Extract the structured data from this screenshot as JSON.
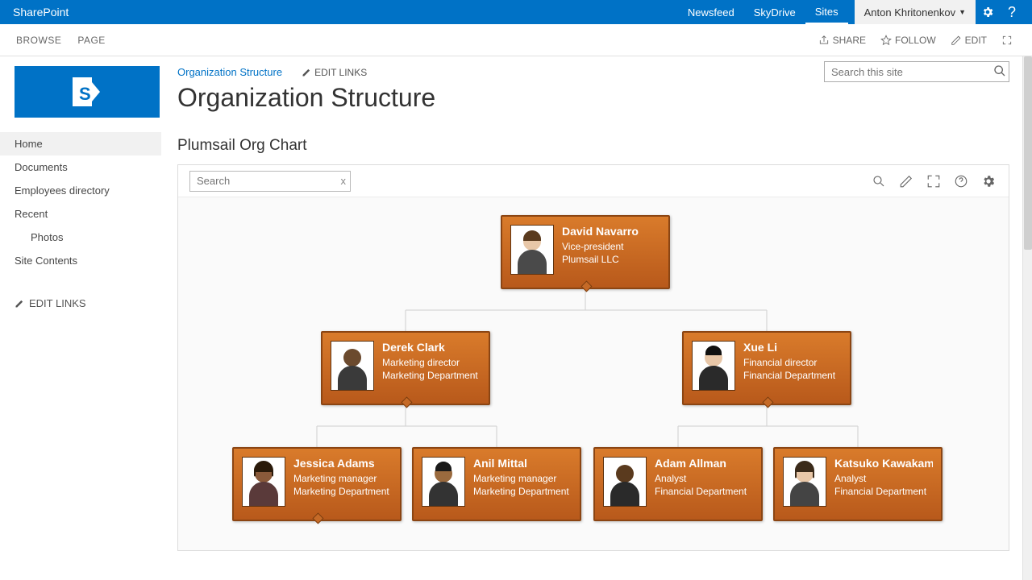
{
  "suitebar": {
    "brand": "SharePoint",
    "links": [
      "Newsfeed",
      "SkyDrive",
      "Sites"
    ],
    "active_link_index": 2,
    "user": "Anton Khritonenkov"
  },
  "ribbon": {
    "tabs": [
      "BROWSE",
      "PAGE"
    ],
    "actions": {
      "share": "SHARE",
      "follow": "FOLLOW",
      "edit": "EDIT"
    }
  },
  "quick_nav": {
    "items": [
      {
        "label": "Home",
        "active": true
      },
      {
        "label": "Documents"
      },
      {
        "label": "Employees directory"
      },
      {
        "label": "Recent"
      },
      {
        "label": "Photos",
        "indent": true
      },
      {
        "label": "Site Contents"
      }
    ],
    "edit_links": "EDIT LINKS"
  },
  "breadcrumb": {
    "link": "Organization Structure",
    "edit_links": "EDIT LINKS"
  },
  "page_title": "Organization Structure",
  "site_search_placeholder": "Search this site",
  "webpart_title": "Plumsail Org Chart",
  "org_search_placeholder": "Search",
  "org_search_clear": "x",
  "nodes": {
    "root": {
      "name": "David Navarro",
      "role": "Vice-president",
      "dept": "Plumsail LLC"
    },
    "l2a": {
      "name": "Derek Clark",
      "role": "Marketing director",
      "dept": "Marketing Department"
    },
    "l2b": {
      "name": "Xue Li",
      "role": "Financial director",
      "dept": "Financial Department"
    },
    "l3a": {
      "name": "Jessica Adams",
      "role": "Marketing manager",
      "dept": "Marketing Department"
    },
    "l3b": {
      "name": "Anil Mittal",
      "role": "Marketing manager",
      "dept": "Marketing Department"
    },
    "l3c": {
      "name": "Adam Allman",
      "role": "Analyst",
      "dept": "Financial Department"
    },
    "l3d": {
      "name": "Katsuko Kawakami",
      "role": "Analyst",
      "dept": "Financial Department"
    }
  }
}
